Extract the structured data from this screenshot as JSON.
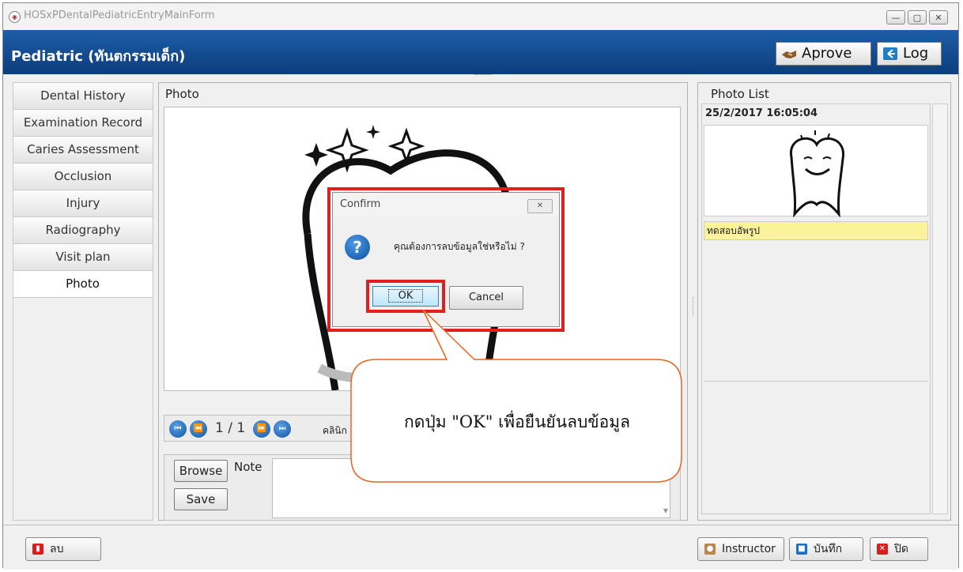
{
  "window": {
    "title": "HOSxPDentalPediatricEntryMainForm",
    "controls": [
      "—",
      "▢",
      "✕"
    ]
  },
  "header": {
    "title": "Pediatric (ทันตกรรมเด็ก)",
    "approve_label": "Aprove",
    "log_label": "Log"
  },
  "tabs": [
    {
      "label": "Dental History"
    },
    {
      "label": "Examination Record"
    },
    {
      "label": "Caries Assessment"
    },
    {
      "label": "Occlusion"
    },
    {
      "label": "Injury"
    },
    {
      "label": "Radiography"
    },
    {
      "label": "Visit plan"
    },
    {
      "label": "Photo",
      "active": true
    }
  ],
  "photo_panel": {
    "title": "Photo",
    "pager": "1 / 1",
    "clinic_label": "คลินิก",
    "browse_label": "Browse",
    "save_label": "Save",
    "note_label": "Note",
    "note_value": ""
  },
  "photo_list": {
    "title": "Photo List",
    "items": [
      {
        "datetime": "25/2/2017 16:05:04",
        "note": "ทดสอบอัพรูป"
      }
    ]
  },
  "dialog": {
    "title": "Confirm",
    "message": "คุณต้องการลบข้อมูลใช่หรือไม่ ?",
    "ok_label": "OK",
    "cancel_label": "Cancel",
    "icon": "question-icon"
  },
  "callout": {
    "text": "กดปุ่ม \"OK\" เพื่อยืนยันลบข้อมูล"
  },
  "footer": {
    "delete_label": "ลบ",
    "instructor_label": "Instructor",
    "save_label": "บันทึก",
    "close_label": "ปิด"
  },
  "colors": {
    "header_bg": "#1d5ea8",
    "highlight_red": "#e02020",
    "callout_border": "#e8641e",
    "note_bg": "#fbf29c"
  }
}
